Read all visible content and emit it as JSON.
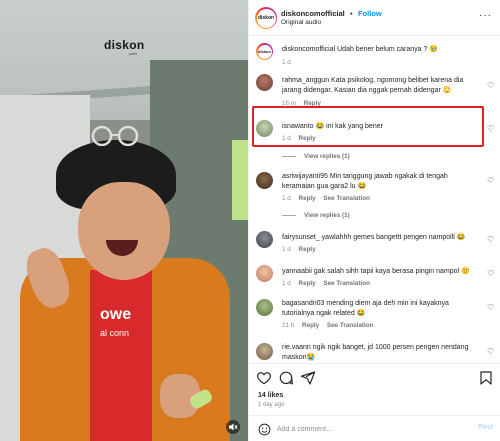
{
  "video": {
    "watermark": "diskon",
    "watermark_sub": ".com",
    "shirt_text": "owe",
    "shirt_sub": "al conn"
  },
  "header": {
    "username": "diskoncomofficial",
    "separator": "•",
    "follow_label": "Follow",
    "audio": "Original audio",
    "avatar_text": "diskon",
    "more": "···"
  },
  "caption": {
    "text": "diskoncomofficial Udah bener belum caranya ? 🥹",
    "time": "1 d"
  },
  "comments": [
    {
      "text": "rahma_anggun Kata psikolog, ngomong belibet karena dia jarang didengar. Kasian dia nggak pernah didengar 🙄",
      "time": "16 m",
      "reply": "Reply"
    },
    {
      "text": "isnawanto 😂 ini kak yang bener",
      "time": "1 d",
      "reply": "Reply",
      "view_replies": "View replies (1)"
    },
    {
      "text": "asriwijayanti95 Min tanggung jawab ngakak di tengah keramaian gua gara2 lu 😂",
      "time": "1 d",
      "reply": "Reply",
      "see_translation": "See Translation",
      "view_replies": "View replies (1)"
    },
    {
      "text": "fairysunset_ yawlahhh gemes bangettt pengen nampolll 😂",
      "time": "1 d",
      "reply": "Reply"
    },
    {
      "text": "yannaabii gak salah sihh tapii kaya berasa pingin nampol 🙂",
      "time": "1 d",
      "reply": "Reply",
      "see_translation": "See Translation"
    },
    {
      "text": "bagasandri03 mending diem aja deh min ini kayaknya tutorialnya ngak related 😂",
      "time": "21 h",
      "reply": "Reply",
      "see_translation": "See Translation"
    },
    {
      "text": "rie.vaann ngik ngik banget, jd 1000 persen pengen nendang maskon😭"
    }
  ],
  "footer": {
    "likes": "14 likes",
    "ago": "1 day ago",
    "add_comment_placeholder": "Add a comment…",
    "post_label": "Post"
  },
  "colors": {
    "accent": "#0095f6",
    "highlight": "#e0211f",
    "jacket": "#d97a1f",
    "shirt": "#d82a2a"
  }
}
